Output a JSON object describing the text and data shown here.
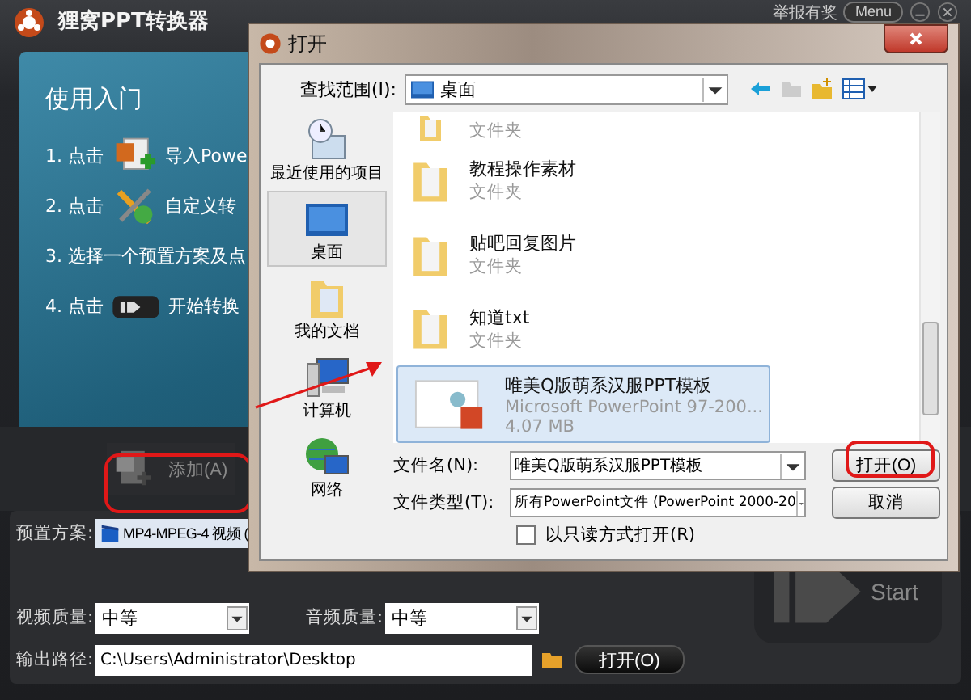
{
  "app": {
    "title": "狸窝PPT转换器",
    "report_link": "举报有奖",
    "menu_button": "Menu"
  },
  "guide": {
    "heading": "使用入门",
    "steps": [
      {
        "kind": "import",
        "prefix": "1. 点击",
        "text": "导入Powe"
      },
      {
        "kind": "tools",
        "prefix": "2. 点击",
        "text": "自定义转"
      },
      {
        "kind": "plain",
        "prefix": "3. 选择一个预置方案及点"
      },
      {
        "kind": "start",
        "prefix": "4. 点击",
        "text": "开始转换"
      }
    ]
  },
  "add_button": "添加(A)",
  "settings": {
    "preset_label": "预置方案:",
    "preset_value": "MP4-MPEG-4 视频 (",
    "video_quality_label": "视频质量:",
    "video_quality": "中等",
    "audio_quality_label": "音频质量:",
    "audio_quality": "中等",
    "output_label": "输出路径:",
    "output_path": "C:\\Users\\Administrator\\Desktop",
    "open_button": "打开(O)"
  },
  "start_button": "Start",
  "dialog": {
    "title": "打开",
    "look_in_label": "查找范围(I):",
    "look_in_value": "桌面",
    "places": [
      {
        "kind": "recent",
        "label": "最近使用的项目",
        "selected": false
      },
      {
        "kind": "desktop",
        "label": "桌面",
        "selected": true
      },
      {
        "kind": "documents",
        "label": "我的文档",
        "selected": false
      },
      {
        "kind": "computer",
        "label": "计算机",
        "selected": false
      },
      {
        "kind": "network",
        "label": "网络",
        "selected": false
      }
    ],
    "files": [
      {
        "kind": "folder",
        "type": "文件夹",
        "selected": false
      },
      {
        "kind": "folder",
        "name": "教程操作素材",
        "type": "文件夹",
        "selected": false
      },
      {
        "kind": "folder",
        "name": "贴吧回复图片",
        "type": "文件夹",
        "selected": false
      },
      {
        "kind": "folder",
        "name": "知道txt",
        "type": "文件夹",
        "selected": false
      },
      {
        "kind": "ppt",
        "name": "唯美Q版萌系汉服PPT模板",
        "type": "Microsoft PowerPoint 97-200...",
        "size": "4.07 MB",
        "selected": true
      }
    ],
    "file_name_label": "文件名(N):",
    "file_name_value": "唯美Q版萌系汉服PPT模板",
    "file_type_label": "文件类型(T):",
    "file_type_value": "所有PowerPoint文件 (PowerPoint 2000-20",
    "readonly_label": "以只读方式打开(R)",
    "readonly_checked": false,
    "open_button": "打开(O)",
    "cancel_button": "取消"
  }
}
